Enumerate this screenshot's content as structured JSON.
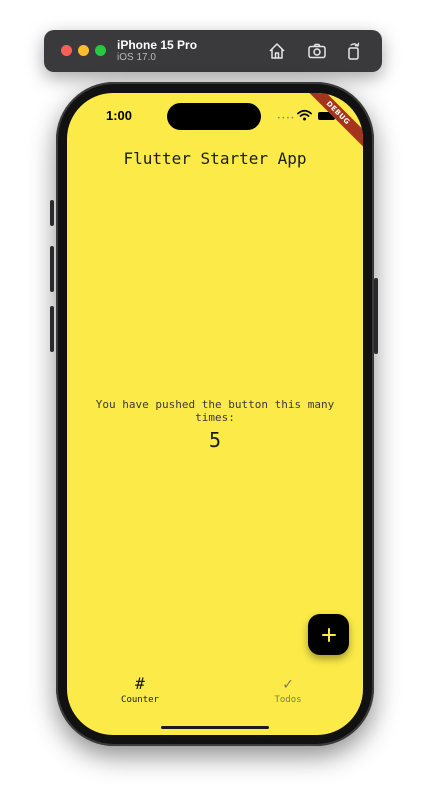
{
  "simulator": {
    "device_name": "iPhone 15 Pro",
    "os_version": "iOS 17.0"
  },
  "status_bar": {
    "time": "1:00",
    "signal_dots": "••••"
  },
  "debug_banner": "DEBUG",
  "app": {
    "title": "Flutter Starter App",
    "counter_label": "You have pushed the button this many times:",
    "counter_value": "5",
    "fab_label": "+"
  },
  "bottom_nav": {
    "items": [
      {
        "icon_text": "#",
        "label": "Counter",
        "selected": true
      },
      {
        "icon_text": "✓",
        "label": "Todos",
        "selected": false
      }
    ]
  },
  "colors": {
    "screen_background": "#fbea48",
    "fab_background": "#000000",
    "fab_icon": "#fbea48",
    "debug_banner": "#a4351c"
  }
}
